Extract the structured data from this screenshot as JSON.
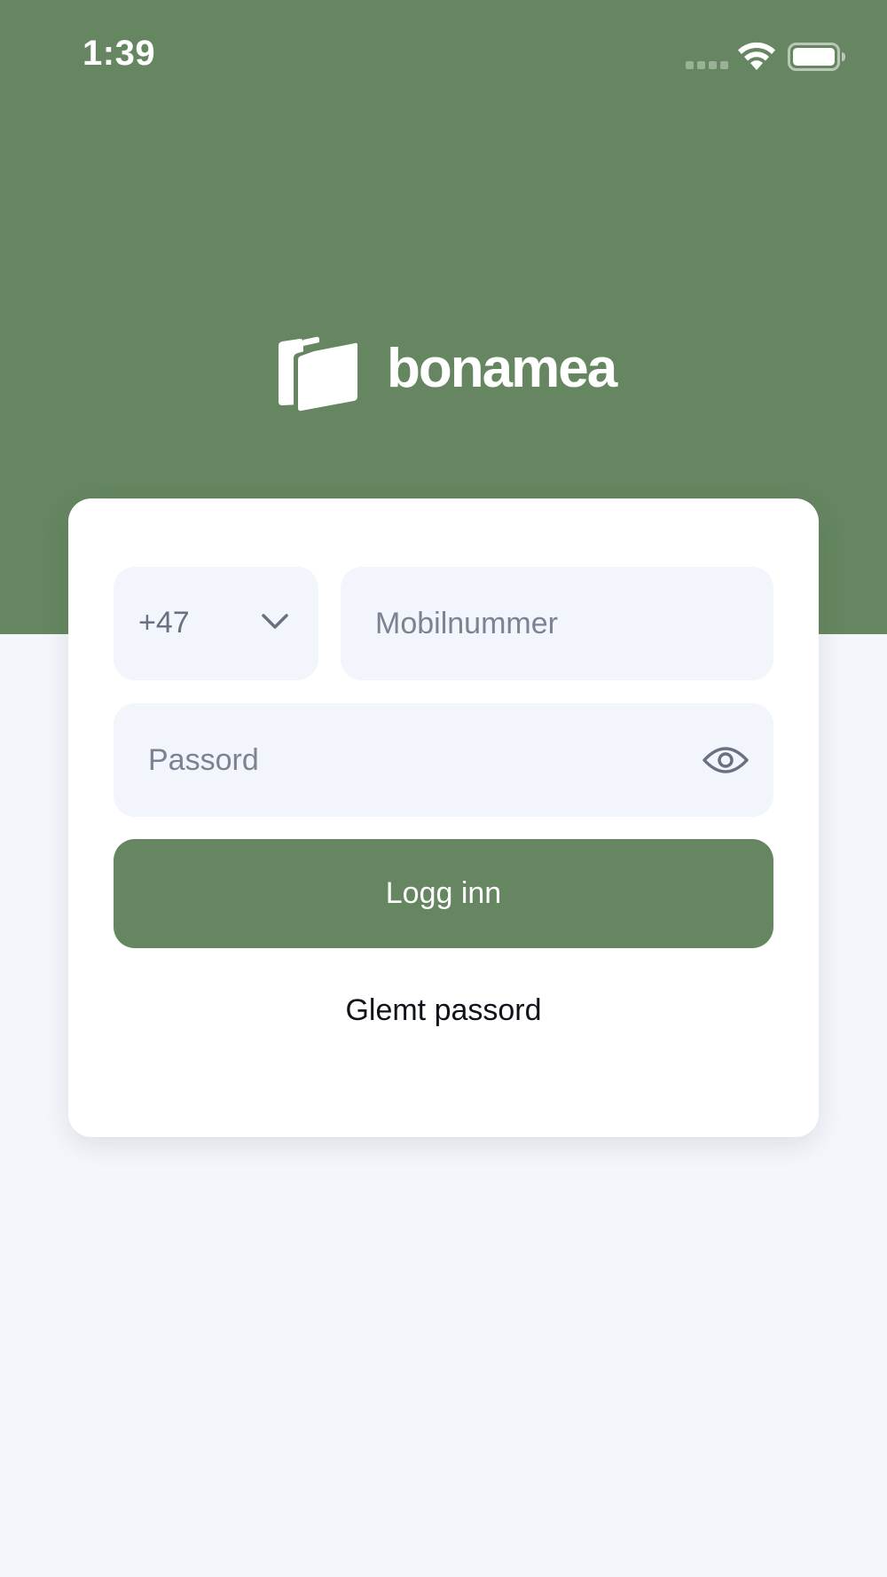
{
  "status_bar": {
    "time": "1:39",
    "wifi_icon": "wifi-icon",
    "battery_icon": "battery-icon"
  },
  "brand": {
    "name": "bonamea",
    "logo_icon": "bonamea-logo-mark",
    "primary_color": "#658660",
    "background_color": "#f3f6fb"
  },
  "login_form": {
    "country_code": "+47",
    "country_chevron_icon": "chevron-down-icon",
    "phone_value": "",
    "phone_placeholder": "Mobilnummer",
    "password_value": "",
    "password_placeholder": "Passord",
    "password_toggle_icon": "eye-icon",
    "submit_label": "Logg inn",
    "forgot_password_label": "Glemt passord"
  }
}
